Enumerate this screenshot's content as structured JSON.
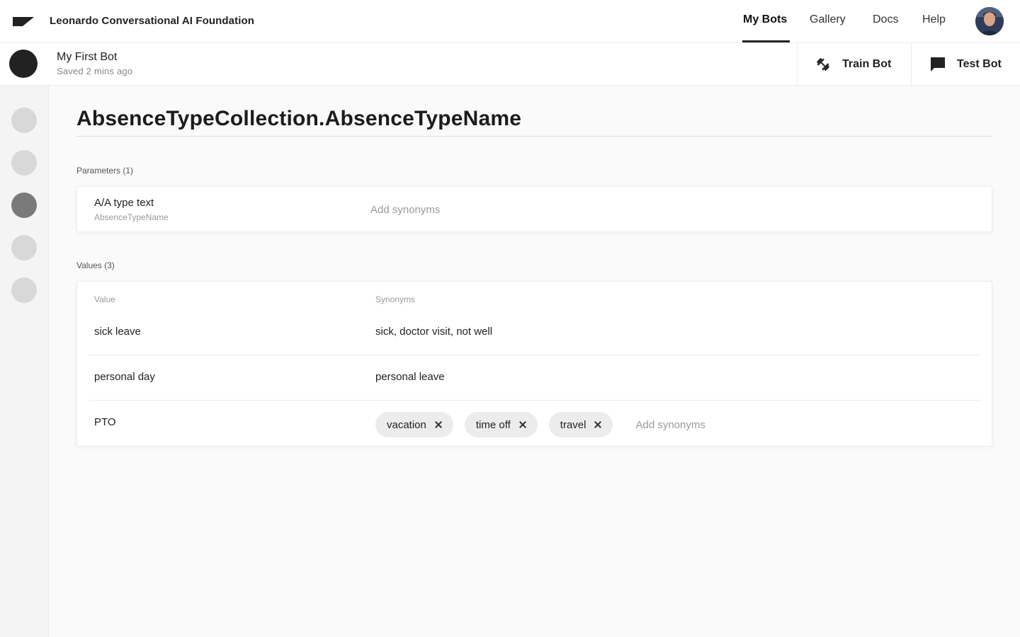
{
  "header": {
    "brand": "Leonardo Conversational AI Foundation",
    "nav": [
      {
        "label": "My Bots",
        "active": true
      },
      {
        "label": "Gallery",
        "active": false
      },
      {
        "label": "Docs",
        "active": false
      },
      {
        "label": "Help",
        "active": false
      }
    ]
  },
  "bot": {
    "name": "My First Bot",
    "saved": "Saved 2 mins ago",
    "train_label": "Train Bot",
    "test_label": "Test Bot"
  },
  "sidebar": {
    "items": [
      {
        "icon": "nav-dot",
        "active": false
      },
      {
        "icon": "nav-dot",
        "active": false
      },
      {
        "icon": "nav-dot",
        "active": true
      },
      {
        "icon": "nav-dot",
        "active": false
      },
      {
        "icon": "nav-dot",
        "active": false
      }
    ]
  },
  "entity": {
    "title": "AbsenceTypeCollection.AbsenceTypeName"
  },
  "parameters": {
    "label": "Parameters (1)",
    "items": [
      {
        "name": "A/A type text",
        "id": "AbsenceTypeName",
        "placeholder": "Add synonyms"
      }
    ]
  },
  "values": {
    "label": "Values (3)",
    "col_value": "Value",
    "col_synonyms": "Synonyms",
    "rows": [
      {
        "value": "sick leave",
        "synonyms": "sick, doctor visit, not well"
      },
      {
        "value": "personal day",
        "synonyms": "personal leave"
      },
      {
        "value": "PTO",
        "chips": [
          "vacation",
          "time off",
          "travel"
        ],
        "placeholder": "Add synonyms"
      }
    ]
  },
  "colors": {
    "accent": "#222222",
    "sidebar_active": "#7a7a7a",
    "sidebar_idle": "#d8d8d8",
    "chip_bg": "#ececec"
  }
}
